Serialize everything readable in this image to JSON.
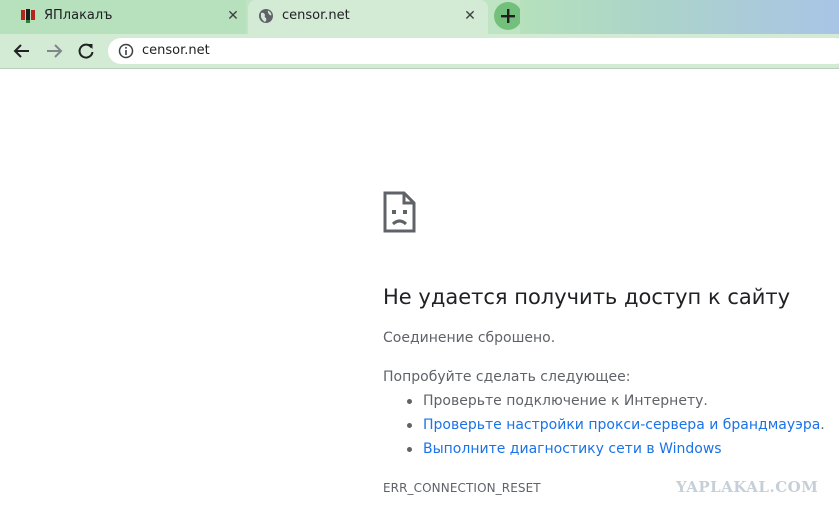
{
  "browser": {
    "tabs": [
      {
        "title": "ЯПлакалъ",
        "icon": "yaplakal-favicon",
        "active": false
      },
      {
        "title": "censor.net",
        "icon": "globe-icon",
        "active": true
      }
    ],
    "new_tab_icon": "plus-icon",
    "close_icon": "close-icon",
    "toolbar": {
      "back_icon": "back-arrow-icon",
      "forward_icon": "forward-arrow-icon",
      "reload_icon": "reload-icon",
      "site_info_icon": "info-icon",
      "url": "censor.net"
    },
    "colors": {
      "tabstrip": "#bfe4c4",
      "toolbar": "#d3ebd5",
      "new_tab_button": "#73c07c",
      "link": "#1a73e8"
    }
  },
  "error_page": {
    "icon": "sad-page-icon",
    "title": "Не удается получить доступ к сайту",
    "description": "Соединение сброшено.",
    "try_label": "Попробуйте сделать следующее:",
    "suggestions": [
      {
        "text": "Проверьте подключение к Интернету.",
        "is_link": false
      },
      {
        "text": "Проверьте настройки прокси-сервера и брандмауэра",
        "suffix": ".",
        "is_link": true
      },
      {
        "text": "Выполните диагностику сети в Windows",
        "is_link": true
      }
    ],
    "error_code": "ERR_CONNECTION_RESET"
  },
  "watermark": "YAPLAKAL.COM"
}
